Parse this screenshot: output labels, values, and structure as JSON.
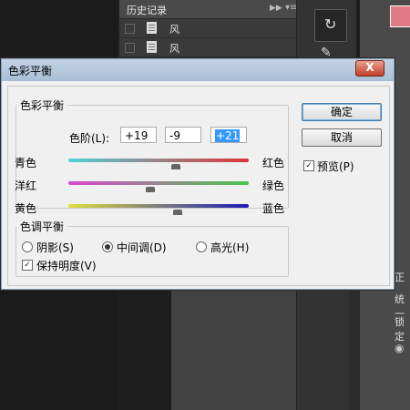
{
  "history_panel": {
    "title": "历史记录",
    "items": [
      "风",
      "风"
    ]
  },
  "dialog": {
    "title": "色彩平衡",
    "close_label": "X",
    "color_balance": {
      "legend": "色彩平衡",
      "levels_label": "色阶(L):",
      "levels": [
        "+19",
        "-9",
        "+21"
      ],
      "sliders": [
        {
          "left": "青色",
          "right": "红色",
          "value": 19
        },
        {
          "left": "洋红",
          "right": "绿色",
          "value": -9
        },
        {
          "left": "黄色",
          "right": "蓝色",
          "value": 21
        }
      ]
    },
    "tone_balance": {
      "legend": "色调平衡",
      "options": [
        "阴影(S)",
        "中间调(D)",
        "高光(H)"
      ],
      "selected": "中间调(D)",
      "preserve_luminosity_label": "保持明度(V)",
      "preserve_luminosity_checked": true
    },
    "buttons": {
      "ok_label": "确定",
      "cancel_label": "取消"
    },
    "preview": {
      "label": "预览(P)",
      "checked": true
    }
  },
  "right_panel": {
    "labels": [
      "正",
      "统一",
      "锁定"
    ]
  },
  "colors": {
    "foreground_swatch": "#e07a85",
    "track_cyan_red": [
      "#4fd1d9",
      "#e03535"
    ],
    "track_magenta_green": [
      "#d948d0",
      "#4ec64e"
    ],
    "track_yellow_blue": [
      "#e0e03a",
      "#1a1ab8"
    ]
  }
}
